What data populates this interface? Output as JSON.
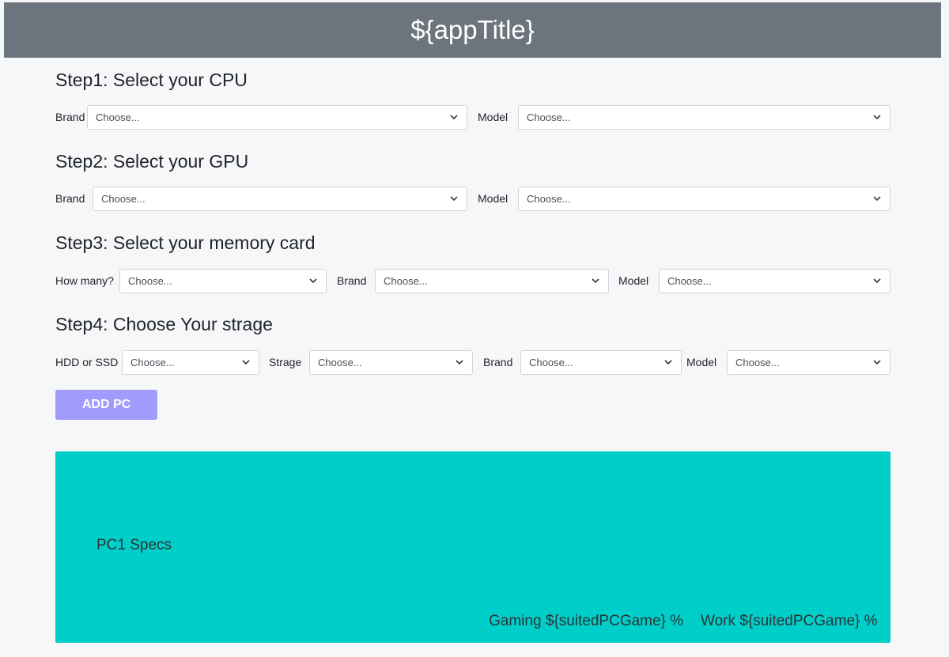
{
  "header": {
    "title": "${appTitle}"
  },
  "steps": {
    "cpu": {
      "title": "Step1: Select your CPU",
      "brand_label": "Brand",
      "brand_value": "Choose...",
      "model_label": "Model",
      "model_value": "Choose..."
    },
    "gpu": {
      "title": "Step2: Select your GPU",
      "brand_label": "Brand",
      "brand_value": "Choose...",
      "model_label": "Model",
      "model_value": "Choose..."
    },
    "memory": {
      "title": "Step3: Select your memory card",
      "count_label": "How many?",
      "count_value": "Choose...",
      "brand_label": "Brand",
      "brand_value": "Choose...",
      "model_label": "Model",
      "model_value": "Choose..."
    },
    "storage": {
      "title": "Step4: Choose Your strage",
      "type_label": "HDD or SSD",
      "type_value": "Choose...",
      "size_label": "Strage",
      "size_value": "Choose...",
      "brand_label": "Brand",
      "brand_value": "Choose...",
      "model_label": "Model",
      "model_value": "Choose..."
    }
  },
  "add_button": {
    "label": "ADD PC"
  },
  "pc_card": {
    "title": "PC1 Specs",
    "gaming": "Gaming ${suitedPCGame} %",
    "work": "Work ${suitedPCGame} %"
  },
  "colors": {
    "header_bg": "#6c757d",
    "button_bg": "#a29bfe",
    "card_bg": "#00cec9",
    "page_bg": "#f6f7f9"
  },
  "icons": {
    "select_arrow": "chevron-down-icon"
  }
}
